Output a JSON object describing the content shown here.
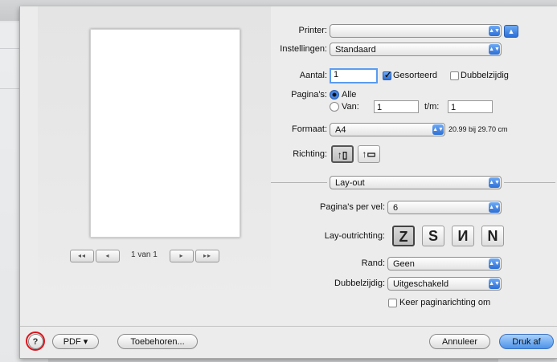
{
  "printer": {
    "label": "Printer:",
    "value": ""
  },
  "settings": {
    "label": "Instellingen:",
    "value": "Standaard"
  },
  "copies": {
    "label": "Aantal:",
    "value": "1",
    "collated_label": "Gesorteerd",
    "collated": true,
    "duplex_label": "Dubbelzijdig",
    "duplex": false
  },
  "pages": {
    "label": "Pagina's:",
    "all_label": "Alle",
    "from_label": "Van:",
    "from_value": "1",
    "to_label": "t/m:",
    "to_value": "1"
  },
  "paper": {
    "label": "Formaat:",
    "value": "A4",
    "size_text": "20.99 bij 29.70 cm"
  },
  "orientation": {
    "label": "Richting:",
    "options": [
      "portrait",
      "landscape"
    ],
    "selected": "portrait"
  },
  "section": {
    "value": "Lay-out"
  },
  "layout": {
    "pages_per_sheet_label": "Pagina's per vel:",
    "pages_per_sheet": "6",
    "direction_label": "Lay-outrichting:",
    "directions": [
      "Z",
      "S",
      "И",
      "N"
    ],
    "direction_selected": 0,
    "border_label": "Rand:",
    "border": "Geen",
    "two_sided_label": "Dubbelzijdig:",
    "two_sided": "Uitgeschakeld",
    "reverse_label": "Keer paginarichting om",
    "reverse": false
  },
  "preview": {
    "page_indicator": "1 van 1"
  },
  "footer": {
    "help": "?",
    "pdf": "PDF ▾",
    "accessories": "Toebehoren...",
    "cancel": "Annuleer",
    "print": "Druk af"
  },
  "colors": {
    "accent": "#2c6fd6",
    "highlight_ring": "#e0141c"
  }
}
